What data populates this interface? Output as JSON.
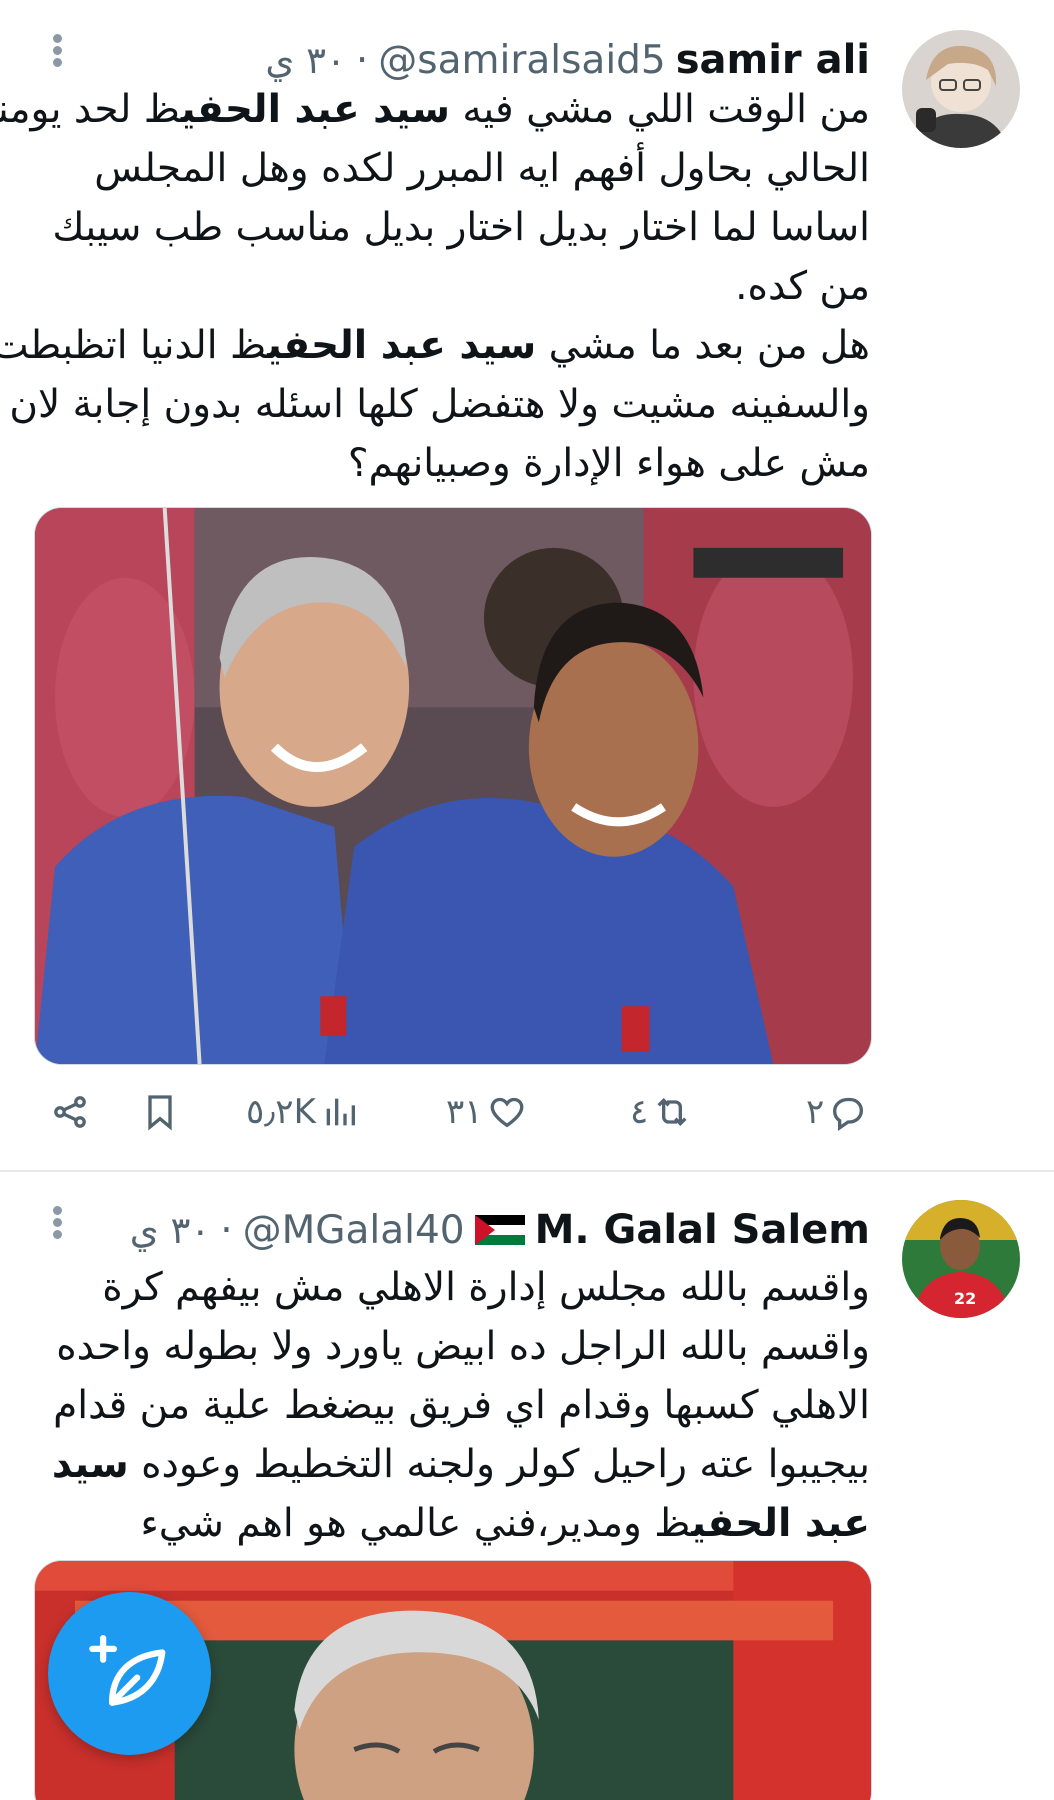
{
  "tweets": [
    {
      "author_name": "samir ali",
      "handle": "@samiralsaid5",
      "time": "٣٠ ي",
      "text_lines": [
        [
          "من الوقت اللي مشي فيه ",
          "سيد عبد الحفي",
          "ظ لحد يومنا"
        ],
        [
          "الحالي بحاول أفهم ايه  المبرر لكده وهل المجلس",
          "",
          ""
        ],
        [
          "اساسا لما اختار بديل اختار بديل مناسب طب سيبك",
          "",
          ""
        ],
        [
          "من  كده.",
          "",
          ""
        ],
        [
          "هل من بعد ما مشي ",
          "سيد عبد الحفي",
          "ظ الدنيا اتظبطت"
        ],
        [
          "والسفينه مشيت ولا هتفضل كلها اسئله بدون إجابة لان",
          "",
          ""
        ],
        [
          "مش على هواء الإدارة وصبيانهم؟",
          "",
          ""
        ]
      ],
      "stats": {
        "replies": "٢",
        "retweets": "٤",
        "likes": "٣١",
        "views": "٥٫٢K"
      },
      "icons": {
        "reply": "reply-icon",
        "retweet": "retweet-icon",
        "like": "heart-icon",
        "views": "views-icon",
        "bookmark": "bookmark-icon",
        "share": "share-icon"
      }
    },
    {
      "author_name": "M. Galal Salem",
      "handle": "@MGalal40",
      "time": "٣٠ ي",
      "text_lines": [
        [
          "واقسم بالله مجلس إدارة الاهلي  مش بيفهم كرة",
          "",
          ""
        ],
        [
          "واقسم بالله الراجل ده ابيض ياورد ولا بطوله واحده",
          "",
          ""
        ],
        [
          "الاهلي كسبها وقدام اي فريق بيضغط علية من قدام",
          "",
          ""
        ],
        [
          "بيجيبوا عته راحيل كولر ولجنه التخطيط  وعوده ",
          "سيد",
          ""
        ],
        [
          "",
          "عبد الحفي",
          "ظ  ومدير،فني عالمي هو اهم شيء"
        ]
      ]
    }
  ],
  "colors": {
    "accent": "#1d9bf0",
    "secondary_text": "#536471",
    "divider": "#e7e9ea"
  },
  "fab": {
    "icon": "compose-tweet-icon"
  }
}
